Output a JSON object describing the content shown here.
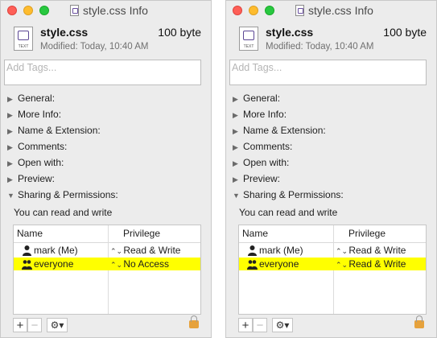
{
  "windows": [
    {
      "title": "style.css Info",
      "file": {
        "name": "style.css",
        "size": "100 byte",
        "modified": "Modified: Today, 10:40 AM",
        "type_label": "TEXT"
      },
      "tags_placeholder": "Add Tags...",
      "sections": [
        "General:",
        "More Info:",
        "Name & Extension:",
        "Comments:",
        "Open with:",
        "Preview:",
        "Sharing & Permissions:"
      ],
      "permission_summary": "You can read and write",
      "table": {
        "headers": {
          "name": "Name",
          "privilege": "Privilege"
        },
        "rows": [
          {
            "name": "mark (Me)",
            "privilege": "Read & Write",
            "icon": "single-user-icon",
            "highlighted": false
          },
          {
            "name": "everyone",
            "privilege": "No Access",
            "icon": "group-icon",
            "highlighted": true
          }
        ]
      }
    },
    {
      "title": "style.css Info",
      "file": {
        "name": "style.css",
        "size": "100 byte",
        "modified": "Modified: Today, 10:40 AM",
        "type_label": "TEXT"
      },
      "tags_placeholder": "Add Tags...",
      "sections": [
        "General:",
        "More Info:",
        "Name & Extension:",
        "Comments:",
        "Open with:",
        "Preview:",
        "Sharing & Permissions:"
      ],
      "permission_summary": "You can read and write",
      "table": {
        "headers": {
          "name": "Name",
          "privilege": "Privilege"
        },
        "rows": [
          {
            "name": "mark (Me)",
            "privilege": "Read & Write",
            "icon": "single-user-icon",
            "highlighted": false
          },
          {
            "name": "everyone",
            "privilege": "Read & Write",
            "icon": "group-icon",
            "highlighted": true
          }
        ]
      }
    }
  ],
  "glyphs": {
    "collapsed": "▶",
    "expanded": "▼",
    "updown": "⌃⌄",
    "add": "+",
    "remove": "−",
    "gear": "⚙▾"
  },
  "colors": {
    "highlight": "#ffff00",
    "close": "#fe5f57",
    "minimize": "#febc2e",
    "maximize": "#28c840",
    "lock": "#e6a23c"
  }
}
